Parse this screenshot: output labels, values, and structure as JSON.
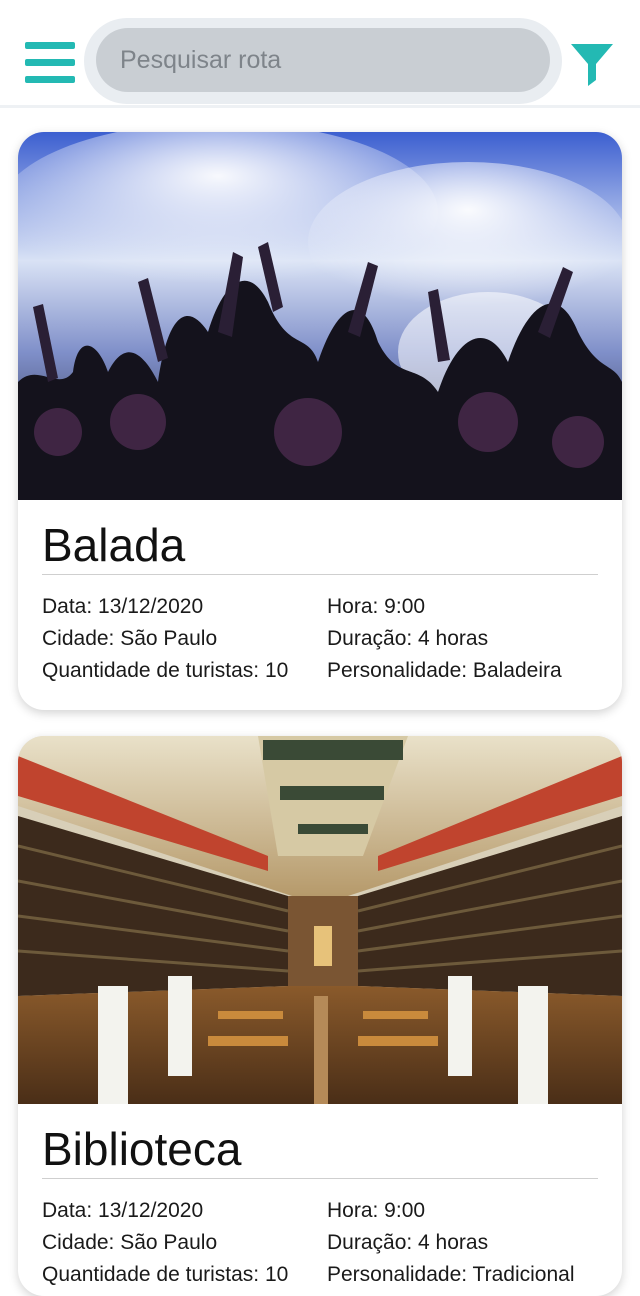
{
  "header": {
    "search": {
      "placeholder": "Pesquisar rota",
      "value": ""
    },
    "menu_icon": "hamburger-menu-icon",
    "filter_icon": "filter-funnel-icon",
    "accent_color": "#23b9b3"
  },
  "routes": [
    {
      "title": "Balada",
      "image": "concert-crowd-photo",
      "date": "Data: 13/12/2020",
      "time": "Hora: 9:00",
      "city": "Cidade: São Paulo",
      "duration": "Duração: 4 horas",
      "tourists": "Quantidade de turistas: 10",
      "personality": "Personalidade: Baladeira"
    },
    {
      "title": "Biblioteca",
      "image": "library-hall-photo",
      "date": "Data: 13/12/2020",
      "time": "Hora: 9:00",
      "city": "Cidade: São Paulo",
      "duration": "Duração: 4 horas",
      "tourists": "Quantidade de turistas: 10",
      "personality": "Personalidade: Tradicional"
    }
  ]
}
